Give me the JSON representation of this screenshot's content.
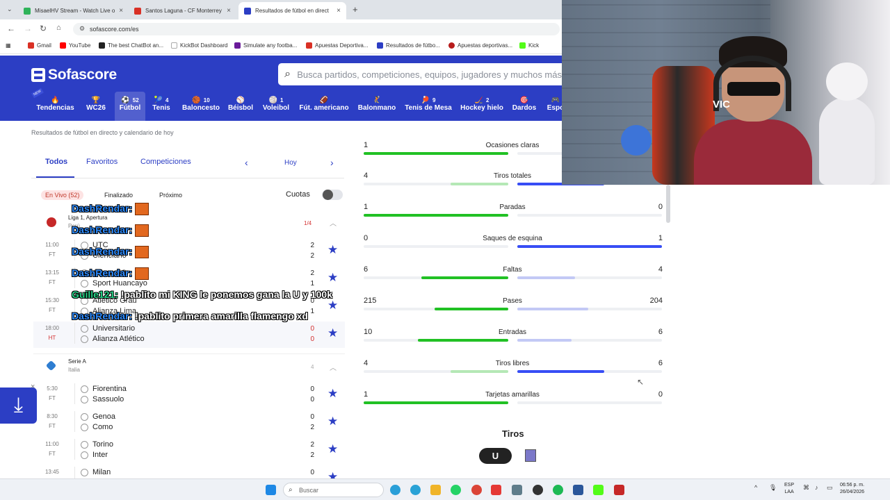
{
  "browser": {
    "tabs": [
      {
        "label": "MisaelHV Stream - Watch Live o",
        "color": "#2fb35a"
      },
      {
        "label": "Santos Laguna - CF Monterrey",
        "color": "#d93025"
      },
      {
        "label": "Resultados de fútbol en direct",
        "color": "#2c3ec4"
      }
    ],
    "new_tab": "+",
    "url": "sofascore.com/es",
    "bookmarks": [
      {
        "label": "Gmail",
        "color": "#d93025"
      },
      {
        "label": "YouTube",
        "color": "#ff0000"
      },
      {
        "label": "The best ChatBot an...",
        "color": "#222"
      },
      {
        "label": "KickBot Dashboard",
        "color": "#ffffff"
      },
      {
        "label": "Simulate any footba...",
        "color": "#6a1b9a"
      },
      {
        "label": "Apuestas Deportiva...",
        "color": "#d93025"
      },
      {
        "label": "Resultados de fútbo...",
        "color": "#2c3ec4"
      },
      {
        "label": "Apuestas deportivas...",
        "color": "#b71c1c"
      },
      {
        "label": "Kick",
        "color": "#53fc18"
      }
    ]
  },
  "site": {
    "logo": "Sofascore",
    "search_placeholder": "Busca partidos, competiciones, equipos, jugadores y muchos más",
    "sports": [
      {
        "label": "Tendencias",
        "count": "",
        "icon": "🔥"
      },
      {
        "label": "WC26",
        "count": "",
        "icon": "🏆"
      },
      {
        "label": "Fútbol",
        "count": "52",
        "icon": "⚽"
      },
      {
        "label": "Tenis",
        "count": "4",
        "icon": "🎾"
      },
      {
        "label": "Baloncesto",
        "count": "10",
        "icon": "🏀"
      },
      {
        "label": "Béisbol",
        "count": "",
        "icon": "⚾"
      },
      {
        "label": "Voleibol",
        "count": "1",
        "icon": "🏐"
      },
      {
        "label": "Fút. americano",
        "count": "",
        "icon": "🏈"
      },
      {
        "label": "Balonmano",
        "count": "",
        "icon": "🤾"
      },
      {
        "label": "Tenis de Mesa",
        "count": "9",
        "icon": "🏓"
      },
      {
        "label": "Hockey hielo",
        "count": "2",
        "icon": "🏒"
      },
      {
        "label": "Dardos",
        "count": "",
        "icon": "🎯"
      },
      {
        "label": "Espo",
        "count": "",
        "icon": "🎮"
      }
    ],
    "new_badge": "NEW"
  },
  "left": {
    "breadcrumb": "Resultados de fútbol en directo y calendario de hoy",
    "tabs": [
      "Todos",
      "Favoritos",
      "Competiciones"
    ],
    "date_label": "Hoy",
    "filters": [
      "En Vivo (52)",
      "Finalizado",
      "Próximo"
    ],
    "odds_label": "Cuotas",
    "league1": {
      "name": "Liga 1, Apertura",
      "country": "Perú",
      "count": "1/4"
    },
    "league2": {
      "name": "Serie A",
      "country": "Italia",
      "count": "4"
    },
    "matches1": [
      {
        "time": "11:00",
        "status": "FT",
        "home": "UTC",
        "away": "Cienciano",
        "hs": "2",
        "as": "2"
      },
      {
        "time": "13:15",
        "status": "FT",
        "home": "Cusco FC",
        "away": "Sport Huancayo",
        "hs": "2",
        "as": "1"
      },
      {
        "time": "15:30",
        "status": "FT",
        "home": "Atlético Grau",
        "away": "Alianza Lima",
        "hs": "0",
        "as": "1"
      },
      {
        "time": "18:00",
        "status": "HT",
        "home": "Universitario",
        "away": "Alianza Atlético",
        "hs": "0",
        "as": "0"
      }
    ],
    "matches2": [
      {
        "time": "5:30",
        "status": "FT",
        "home": "Fiorentina",
        "away": "Sassuolo",
        "hs": "0",
        "as": "0"
      },
      {
        "time": "8:30",
        "status": "FT",
        "home": "Genoa",
        "away": "Como",
        "hs": "0",
        "as": "2"
      },
      {
        "time": "11:00",
        "status": "FT",
        "home": "Torino",
        "away": "Inter",
        "hs": "2",
        "as": "2"
      },
      {
        "time": "13:45",
        "status": "",
        "home": "Milan",
        "away": "",
        "hs": "0",
        "as": ""
      }
    ]
  },
  "chat": [
    {
      "user": "DashRendar:",
      "msg": "",
      "emote": true
    },
    {
      "user": "DashRendar:",
      "msg": "",
      "emote": true
    },
    {
      "user": "DashRendar:",
      "msg": "",
      "emote": true
    },
    {
      "user": "DashRendar:",
      "msg": "",
      "emote": true
    },
    {
      "user": "Guille121:",
      "msg": "!pablito mi KING le ponemos gana la U y 100k",
      "emote": false
    },
    {
      "user": "DashRendar:",
      "msg": "!pablito primera amarilla flamengo xd",
      "emote": false
    }
  ],
  "stats": [
    {
      "name": "Ocasiones claras",
      "home": "1",
      "away": "",
      "hf": 1.0,
      "af": 0.0
    },
    {
      "name": "Tiros totales",
      "home": "4",
      "away": "",
      "hf": 0.4,
      "af": 0.6
    },
    {
      "name": "Paradas",
      "home": "1",
      "away": "0",
      "hf": 1.0,
      "af": 0.0
    },
    {
      "name": "Saques de esquina",
      "home": "0",
      "away": "1",
      "hf": 0.0,
      "af": 1.0
    },
    {
      "name": "Faltas",
      "home": "6",
      "away": "4",
      "hf": 0.6,
      "af": 0.4
    },
    {
      "name": "Pases",
      "home": "215",
      "away": "204",
      "hf": 0.51,
      "af": 0.49
    },
    {
      "name": "Entradas",
      "home": "10",
      "away": "6",
      "hf": 0.625,
      "af": 0.375
    },
    {
      "name": "Tiros libres",
      "home": "4",
      "away": "6",
      "hf": 0.4,
      "af": 0.6
    },
    {
      "name": "Tarjetas amarillas",
      "home": "1",
      "away": "0",
      "hf": 1.0,
      "af": 0.0
    }
  ],
  "shots_title": "Tiros",
  "shots_home_badge": "U",
  "cam_text": "VIC",
  "taskbar": {
    "search_placeholder": "Buscar",
    "lang": [
      "ESP",
      "LAA"
    ],
    "time": "06:56 p. m.",
    "date": "26/04/2026"
  },
  "colors": {
    "accent": "#2c3ec4",
    "home": "#21c124",
    "away": "#374df5"
  }
}
